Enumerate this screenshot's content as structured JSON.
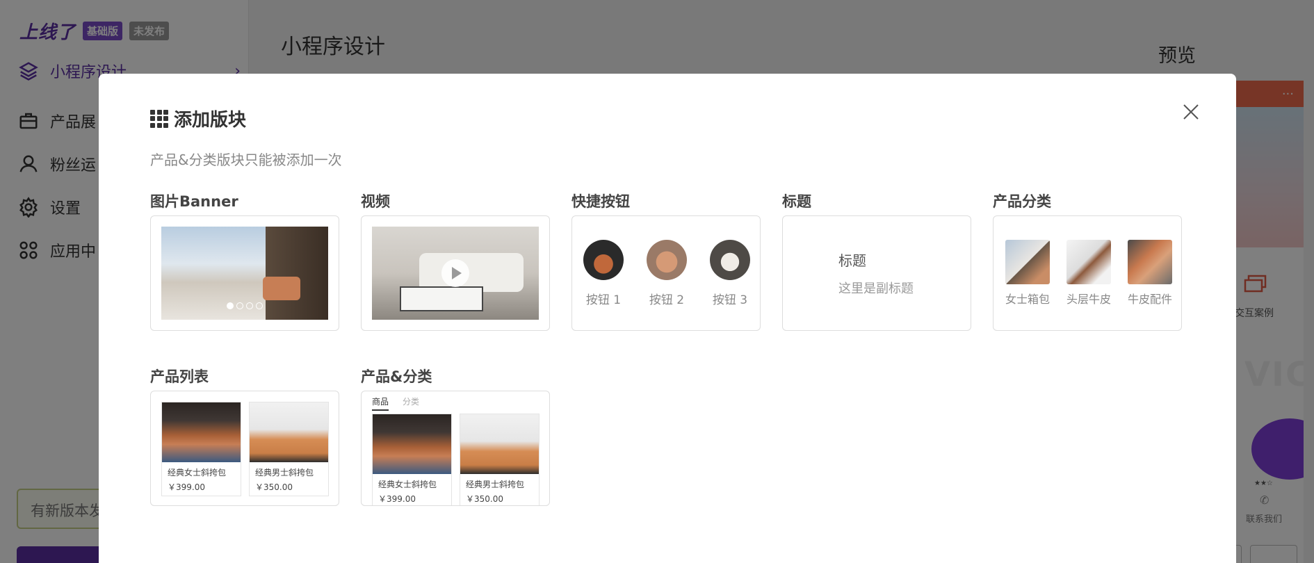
{
  "app": {
    "logo": "上线了",
    "plan_badge": "基础版",
    "status_badge": "未发布"
  },
  "sidebar": {
    "items": [
      {
        "label": "小程序设计",
        "icon": "layers-icon",
        "active": true
      },
      {
        "label": "产品展",
        "icon": "briefcase-icon"
      },
      {
        "label": "粉丝运",
        "icon": "user-icon"
      },
      {
        "label": "设置",
        "icon": "gear-icon"
      },
      {
        "label": "应用中",
        "icon": "apps-icon"
      }
    ],
    "update_notice": "有新版本发"
  },
  "main": {
    "title": "小程序设计",
    "preview_label": "预览",
    "bottom_link": "...",
    "phone": {
      "header_more": "···",
      "case_label": "交互案例",
      "stars": "★★☆",
      "contact_label": "联系我们"
    }
  },
  "modal": {
    "title": "添加版块",
    "subtitle": "产品&分类版块只能被添加一次",
    "blocks": {
      "banner": {
        "label": "图片Banner"
      },
      "video": {
        "label": "视频"
      },
      "quick_buttons": {
        "label": "快捷按钮",
        "buttons": [
          "按钮 1",
          "按钮 2",
          "按钮 3"
        ]
      },
      "title_block": {
        "label": "标题",
        "title": "标题",
        "subtitle": "这里是副标题"
      },
      "category": {
        "label": "产品分类",
        "items": [
          "女士箱包",
          "头层牛皮",
          "牛皮配件"
        ]
      },
      "product_list": {
        "label": "产品列表",
        "products": [
          {
            "name": "经典女士斜挎包",
            "price": "￥399.00"
          },
          {
            "name": "经典男士斜挎包",
            "price": "￥350.00"
          }
        ]
      },
      "product_category": {
        "label": "产品&分类",
        "tabs": [
          "商品",
          "分类"
        ],
        "products": [
          {
            "name": "经典女士斜挎包",
            "price": "￥399.00"
          },
          {
            "name": "经典男士斜挎包",
            "price": "￥350.00"
          }
        ]
      }
    }
  },
  "colors": {
    "brand": "#5b2fa3",
    "accent": "#7b4cc9",
    "phone_header": "#ee6a4d"
  }
}
